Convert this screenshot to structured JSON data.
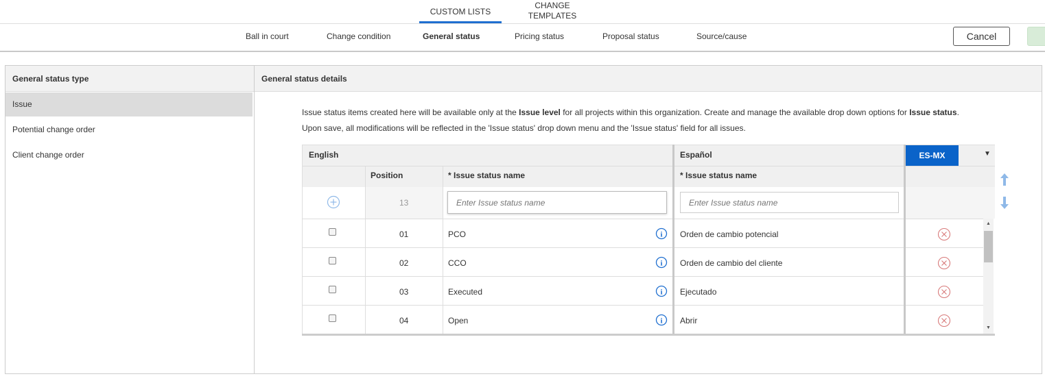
{
  "top_tabs": [
    {
      "label": "CUSTOM LISTS",
      "active": true
    },
    {
      "label_line1": "CHANGE",
      "label_line2": "TEMPLATES",
      "active": false
    }
  ],
  "sub_tabs": [
    "Ball in court",
    "Change condition",
    "General status",
    "Pricing status",
    "Proposal status",
    "Source/cause"
  ],
  "active_sub_tab": "General status",
  "actions": {
    "cancel_label": "Cancel"
  },
  "left_panel": {
    "title": "General status type",
    "items": [
      "Issue",
      "Potential change order",
      "Client change order"
    ],
    "selected": "Issue"
  },
  "right_panel": {
    "title": "General status details",
    "description": {
      "l1_a": "Issue status items created here will be available only at the ",
      "l1_b": "Issue level",
      "l1_c": " for all projects within this organization. Create and manage the available drop down options for ",
      "l1_d": "Issue status",
      "l1_e": ".",
      "l2": "Upon save, all modifications will be reflected in the 'Issue status' drop down menu and the 'Issue status' field for all issues."
    }
  },
  "grid": {
    "group_english": "English",
    "group_spanish": "Español",
    "locale_badge": "ES-MX",
    "col_position": "Position",
    "col_name_en": "* Issue status name",
    "col_name_es": "* Issue status name",
    "new_row": {
      "position": "13",
      "placeholder_en": "Enter Issue status name",
      "placeholder_es": "Enter Issue status name"
    },
    "rows": [
      {
        "position": "01",
        "name": "PCO",
        "name_es": "Orden de cambio potencial"
      },
      {
        "position": "02",
        "name": "CCO",
        "name_es": "Orden de cambio del cliente"
      },
      {
        "position": "03",
        "name": "Executed",
        "name_es": "Ejecutado"
      },
      {
        "position": "04",
        "name": "Open",
        "name_es": "Abrir"
      }
    ]
  },
  "colors": {
    "accent": "#1f6fd0",
    "badge": "#0a63c9",
    "delete": "#d87a7a",
    "arrows": "#8fb9e8"
  }
}
